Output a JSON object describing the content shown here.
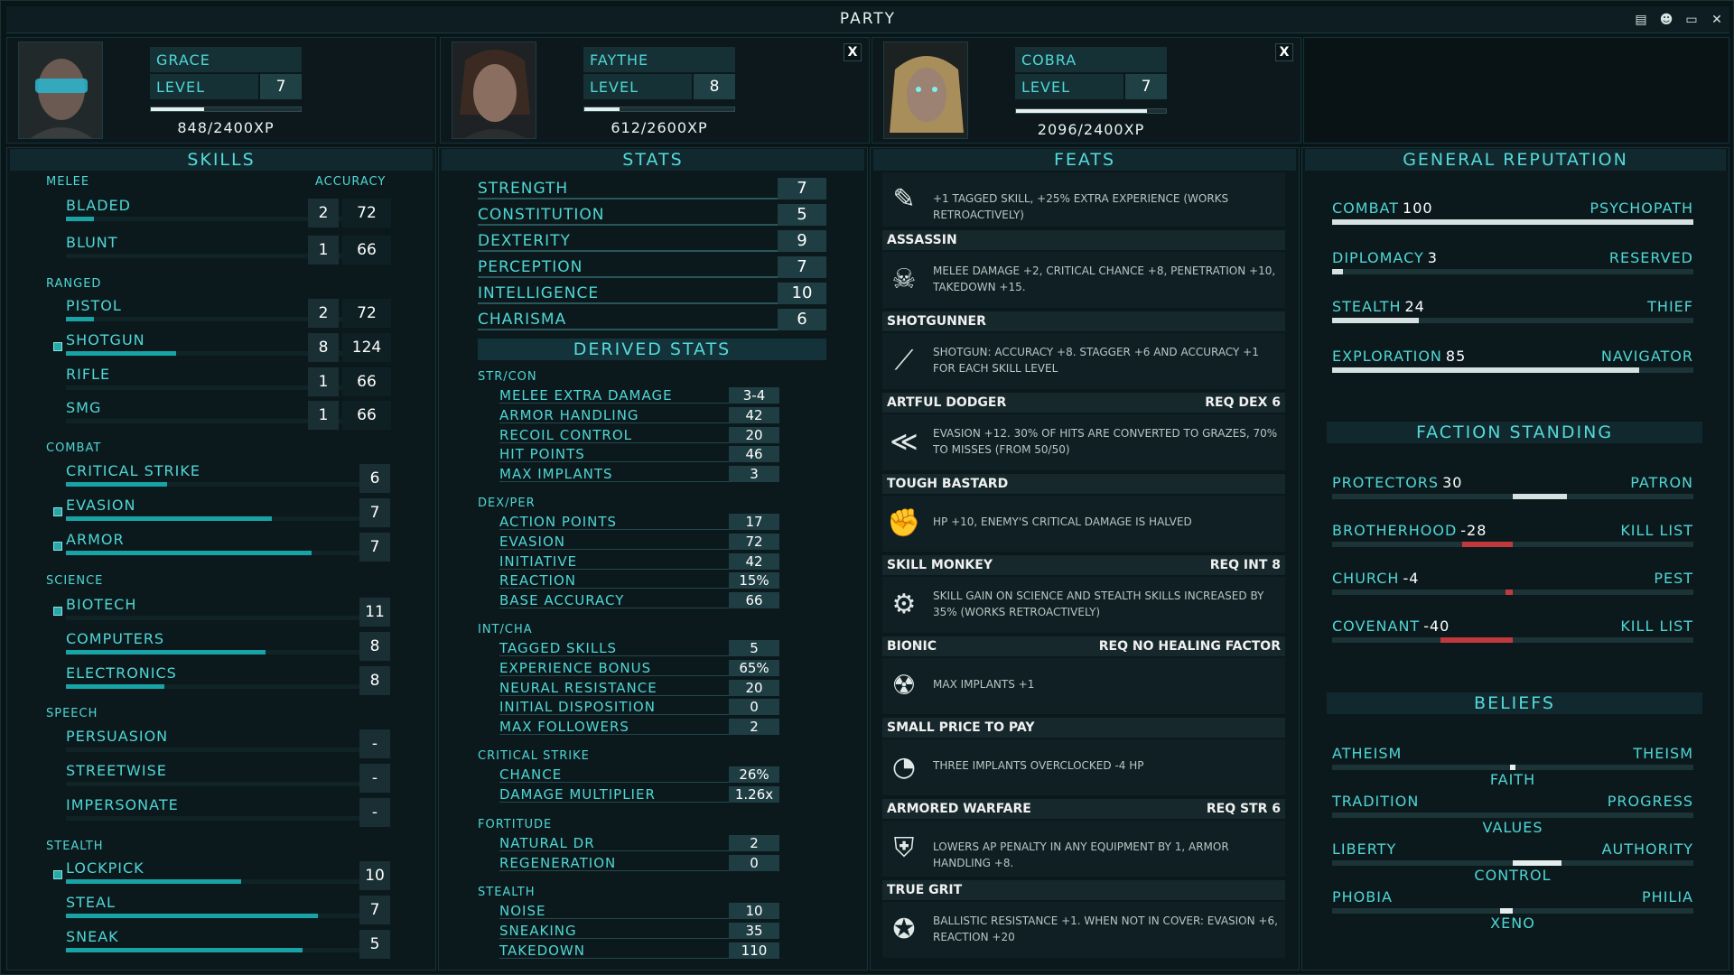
{
  "window": {
    "title": "PARTY"
  },
  "characters": [
    {
      "name": "GRACE",
      "level_label": "LEVEL",
      "level": "7",
      "xp": "848/2400XP",
      "xp_frac": 0.353
    },
    {
      "name": "FAYTHE",
      "level_label": "LEVEL",
      "level": "8",
      "xp": "612/2600XP",
      "xp_frac": 0.235
    },
    {
      "name": "COBRA",
      "level_label": "LEVEL",
      "level": "7",
      "xp": "2096/2400XP",
      "xp_frac": 0.873
    }
  ],
  "headers": {
    "skills": "SKILLS",
    "stats": "STATS",
    "feats": "FEATS",
    "rep": "GENERAL REPUTATION",
    "derived": "DERIVED STATS",
    "faction": "FACTION STANDING",
    "beliefs": "BELIEFS"
  },
  "skills": {
    "melee": "MELEE",
    "accuracy": "ACCURACY",
    "ranged": "RANGED",
    "combat": "COMBAT",
    "science": "SCIENCE",
    "speech": "SPEECH",
    "stealth": "STEALTH",
    "items": [
      {
        "name": "BLADED",
        "v": "2",
        "acc": "72",
        "bar": 0.09,
        "tag": false
      },
      {
        "name": "BLUNT",
        "v": "1",
        "acc": "66",
        "bar": 0,
        "tag": false
      },
      {
        "name": "PISTOL",
        "v": "2",
        "acc": "72",
        "bar": 0.09,
        "tag": false
      },
      {
        "name": "SHOTGUN",
        "v": "8",
        "acc": "124",
        "bar": 0.36,
        "tag": true
      },
      {
        "name": "RIFLE",
        "v": "1",
        "acc": "66",
        "bar": 0,
        "tag": false
      },
      {
        "name": "SMG",
        "v": "1",
        "acc": "66",
        "bar": 0,
        "tag": false
      },
      {
        "name": "CRITICAL STRIKE",
        "v": "6",
        "bar": 0.33,
        "tag": false
      },
      {
        "name": "EVASION",
        "v": "7",
        "bar": 0.67,
        "tag": true
      },
      {
        "name": "ARMOR",
        "v": "7",
        "bar": 0.8,
        "tag": true
      },
      {
        "name": "BIOTECH",
        "v": "11",
        "bar": 0,
        "tag": true
      },
      {
        "name": "COMPUTERS",
        "v": "8",
        "bar": 0.65,
        "tag": false
      },
      {
        "name": "ELECTRONICS",
        "v": "8",
        "bar": 0.32,
        "tag": false
      },
      {
        "name": "PERSUASION",
        "v": "-",
        "bar": 0,
        "tag": false
      },
      {
        "name": "STREETWISE",
        "v": "-",
        "bar": 0,
        "tag": false
      },
      {
        "name": "IMPERSONATE",
        "v": "-",
        "bar": 0,
        "tag": false
      },
      {
        "name": "LOCKPICK",
        "v": "10",
        "bar": 0.57,
        "tag": true
      },
      {
        "name": "STEAL",
        "v": "7",
        "bar": 0.82,
        "tag": false
      },
      {
        "name": "SNEAK",
        "v": "5",
        "bar": 0.77,
        "tag": false
      }
    ]
  },
  "stats": [
    {
      "name": "STRENGTH",
      "v": "7"
    },
    {
      "name": "CONSTITUTION",
      "v": "5"
    },
    {
      "name": "DEXTERITY",
      "v": "9"
    },
    {
      "name": "PERCEPTION",
      "v": "7"
    },
    {
      "name": "INTELLIGENCE",
      "v": "10"
    },
    {
      "name": "CHARISMA",
      "v": "6"
    }
  ],
  "derived": {
    "g1": "STR/CON",
    "g2": "DEX/PER",
    "g3": "INT/CHA",
    "g4": "CRITICAL STRIKE",
    "g5": "FORTITUDE",
    "g6": "STEALTH",
    "rows": [
      {
        "n": "MELEE EXTRA DAMAGE",
        "v": "3-4"
      },
      {
        "n": "ARMOR HANDLING",
        "v": "42"
      },
      {
        "n": "RECOIL CONTROL",
        "v": "20"
      },
      {
        "n": "HIT POINTS",
        "v": "46"
      },
      {
        "n": "MAX IMPLANTS",
        "v": "3"
      },
      {
        "n": "ACTION POINTS",
        "v": "17"
      },
      {
        "n": "EVASION",
        "v": "72"
      },
      {
        "n": "INITIATIVE",
        "v": "42"
      },
      {
        "n": "REACTION",
        "v": "15%"
      },
      {
        "n": "BASE ACCURACY",
        "v": "66"
      },
      {
        "n": "TAGGED SKILLS",
        "v": "5"
      },
      {
        "n": "EXPERIENCE BONUS",
        "v": "65%"
      },
      {
        "n": "NEURAL RESISTANCE",
        "v": "20"
      },
      {
        "n": "INITIAL DISPOSITION",
        "v": "0"
      },
      {
        "n": "MAX FOLLOWERS",
        "v": "2"
      },
      {
        "n": "CHANCE",
        "v": "26%"
      },
      {
        "n": "DAMAGE MULTIPLIER",
        "v": "1.26x"
      },
      {
        "n": "NATURAL DR",
        "v": "2"
      },
      {
        "n": "REGENERATION",
        "v": "0"
      },
      {
        "n": "NOISE",
        "v": "10"
      },
      {
        "n": "SNEAKING",
        "v": "35"
      },
      {
        "n": "TAKEDOWN",
        "v": "110"
      }
    ]
  },
  "feats": [
    {
      "title": "",
      "req": "",
      "text": "+1 TAGGED SKILL, +25% EXTRA EXPERIENCE (WORKS RETROACTIVELY)",
      "icon": "book-icon"
    },
    {
      "title": "ASSASSIN",
      "req": "",
      "text": "MELEE DAMAGE +2, CRITICAL CHANCE +8, PENETRATION +10, TAKEDOWN +15.",
      "icon": "skull-icon"
    },
    {
      "title": "SHOTGUNNER",
      "req": "",
      "text": "SHOTGUN: ACCURACY +8. STAGGER +6 AND ACCURACY +1 FOR EACH SKILL LEVEL",
      "icon": "shotgun-icon"
    },
    {
      "title": "ARTFUL DODGER",
      "req": "REQ DEX 6",
      "text": "EVASION +12. 30% OF HITS ARE CONVERTED TO GRAZES, 70% TO MISSES (FROM 50/50)",
      "icon": "dodge-icon"
    },
    {
      "title": "TOUGH BASTARD",
      "req": "",
      "text": "HP +10, ENEMY'S CRITICAL DAMAGE IS HALVED",
      "icon": "fist-icon"
    },
    {
      "title": "SKILL MONKEY",
      "req": "REQ INT 8",
      "text": "SKILL GAIN ON SCIENCE AND STEALTH SKILLS INCREASED BY 35% (WORKS RETROACTIVELY)",
      "icon": "gear-icon"
    },
    {
      "title": "BIONIC",
      "req": "REQ NO HEALING FACTOR",
      "text": "MAX IMPLANTS +1",
      "icon": "bionic-head-icon"
    },
    {
      "title": "SMALL PRICE TO PAY",
      "req": "",
      "text": "THREE IMPLANTS OVERCLOCKED -4 HP",
      "icon": "gauge-icon"
    },
    {
      "title": "ARMORED WARFARE",
      "req": "REQ STR 6",
      "text": "LOWERS AP PENALTY IN ANY EQUIPMENT BY 1, ARMOR HANDLING +8.",
      "icon": "armor-icon"
    },
    {
      "title": "TRUE GRIT",
      "req": "",
      "text": "BALLISTIC RESISTANCE +1. WHEN NOT IN COVER: EVASION +6, REACTION +20",
      "icon": "star-badge-icon"
    }
  ],
  "reputation": [
    {
      "name": "COMBAT",
      "val": "100",
      "right": "PSYCHOPATH",
      "frac": 1.0
    },
    {
      "name": "DIPLOMACY",
      "val": "3",
      "right": "RESERVED",
      "frac": 0.03
    },
    {
      "name": "STEALTH",
      "val": "24",
      "right": "THIEF",
      "frac": 0.24
    },
    {
      "name": "EXPLORATION",
      "val": "85",
      "right": "NAVIGATOR",
      "frac": 0.85
    }
  ],
  "factions": [
    {
      "name": "PROTECTORS",
      "val": "30",
      "right": "PATRON",
      "frac": 0.3
    },
    {
      "name": "BROTHERHOOD",
      "val": "-28",
      "right": "KILL LIST",
      "frac": -0.28
    },
    {
      "name": "CHURCH",
      "val": "-4",
      "right": "PEST",
      "frac": -0.04
    },
    {
      "name": "COVENANT",
      "val": "-40",
      "right": "KILL LIST",
      "frac": -0.4
    }
  ],
  "beliefs": [
    {
      "left": "ATHEISM",
      "right": "THEISM",
      "label": "FAITH",
      "pos": 0.0,
      "width": 0.02
    },
    {
      "left": "TRADITION",
      "right": "PROGRESS",
      "label": "VALUES",
      "pos": 0.0,
      "width": 0.0
    },
    {
      "left": "LIBERTY",
      "right": "AUTHORITY",
      "label": "CONTROL",
      "pos": 0.0,
      "width": 0.27
    },
    {
      "left": "PHOBIA",
      "right": "PHILIA",
      "label": "XENO",
      "pos": -0.07,
      "width": 0.07
    }
  ],
  "colors": {
    "accent": "#49d6d6",
    "negative": "#c2393d",
    "positive": "#d6e2e2"
  }
}
